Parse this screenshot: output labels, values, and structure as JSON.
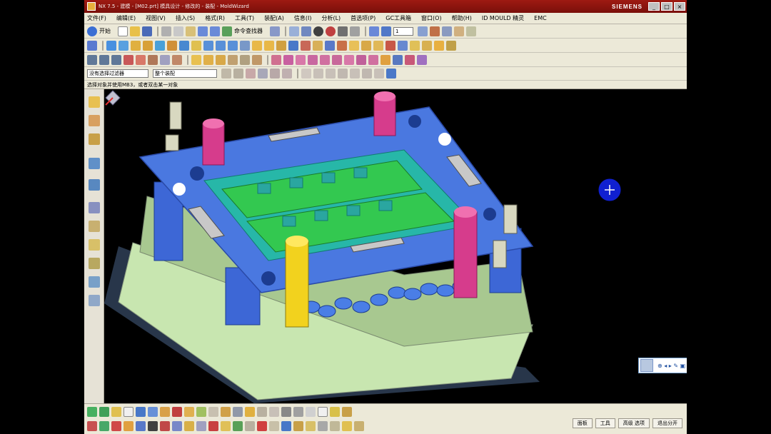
{
  "titlebar": {
    "title": "NX 7.5 - 建模 - [M02.prt] 模具设计 - 修改的 - 装配 - MoldWizard",
    "brand": "SIEMENS"
  },
  "menubar": {
    "items": [
      "文件(F)",
      "编辑(E)",
      "视图(V)",
      "插入(S)",
      "格式(R)",
      "工具(T)",
      "装配(A)",
      "信息(I)",
      "分析(L)",
      "首选项(P)",
      "GC工具箱",
      "窗口(O)",
      "帮助(H)",
      "ID MOULD 精灵",
      "EMC"
    ]
  },
  "toolbar1": {
    "start_label": "开始",
    "command_finder": "命令查找器"
  },
  "filterbar": {
    "filter_select": "没有选择过滤器",
    "assembly_select": "整个装配"
  },
  "statusline": {
    "text": "选择对象并使用MB3，或者双击某一对象"
  },
  "bottombar": {
    "buttons": [
      "面板",
      "工具",
      "高级 选项",
      "退出分开"
    ]
  },
  "colors": {
    "titlebar": "#9e1a12",
    "plate_blue": "#4a78e0",
    "core_green": "#33c850",
    "cavity_teal": "#27b7a8",
    "base_lightgreen": "#c8e6b0",
    "guide_magenta": "#d63c8c",
    "guide_yellow": "#f2d21e"
  },
  "icons": [
    "start-icon",
    "new-icon",
    "open-icon",
    "save-icon",
    "undo-icon",
    "redo-icon",
    "fit-view-icon",
    "shaded-icon",
    "measure-icon",
    "sketch-icon",
    "extrude-icon",
    "hole-icon",
    "line-icon",
    "arc-icon",
    "rectangle-icon",
    "snap-point-icon"
  ]
}
